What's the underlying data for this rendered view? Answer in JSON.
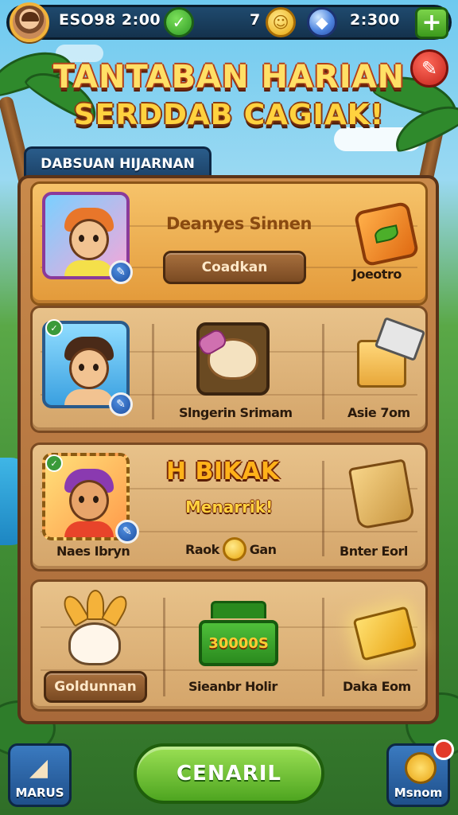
{
  "topbar": {
    "player_stat": "ESO98 2:00",
    "coin_count": "7",
    "gem_stat": "2:300",
    "check_icon": "check-icon",
    "coin_icon": "coin-icon",
    "gem_icon": "gem-icon",
    "add_icon": "plus-icon"
  },
  "header": {
    "title_line1": "TANTABAN HARIAN",
    "title_line2": "SERDDAB CAGIAK!",
    "close_icon": "close-icon"
  },
  "panel": {
    "tab_label": "DABSUAN HIJARNAN"
  },
  "cards": [
    {
      "heading": "Deanyes Sinnen",
      "button_label": "Coadkan",
      "reward_label": "Joeotro"
    },
    {
      "middle_label": "Slngerin Srimam",
      "reward_label": "Asie 7om"
    },
    {
      "banner_title": "H BIKAK",
      "banner_subtitle": "Menarrik!",
      "portrait_label": "Naes Ibryn",
      "middle_label_left": "Raok",
      "middle_label_right": "Gan",
      "reward_label": "Bnter Eorl"
    },
    {
      "button_label": "Goldunnan",
      "chest_value": "30000S",
      "middle_label": "Sieanbr Holir",
      "reward_label": "Daka Eom"
    }
  ],
  "bottom": {
    "left_label": "MARUS",
    "center_label": "CENARIL",
    "right_label": "Msnom"
  },
  "colors": {
    "accent_gold": "#ffd23f",
    "panel_wood": "#c98a4b",
    "button_green": "#4ea520",
    "topbar_navy": "#1f4a6e"
  }
}
